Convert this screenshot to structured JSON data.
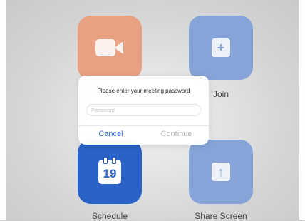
{
  "home": {
    "tiles": [
      {
        "name": "new-meeting",
        "icon": "video-camera-icon",
        "label": ""
      },
      {
        "name": "join",
        "icon": "plus-icon",
        "label": "Join",
        "glyph": "+"
      },
      {
        "name": "schedule",
        "icon": "calendar-icon",
        "label": "Schedule",
        "calendar_day": "19"
      },
      {
        "name": "share-screen",
        "icon": "share-up-arrow-icon",
        "label": "Share Screen",
        "glyph": "↑"
      }
    ]
  },
  "dialog": {
    "title": "Please enter your meeting password",
    "password_placeholder": "Password",
    "password_value": "",
    "cancel_label": "Cancel",
    "continue_label": "Continue"
  },
  "colors": {
    "new_meeting_tile": "#e9a184",
    "blue_tile": "#86a4d8",
    "schedule_tile": "#2a63c8",
    "accent": "#2f6fd6",
    "disabled": "#b9b9b9"
  }
}
